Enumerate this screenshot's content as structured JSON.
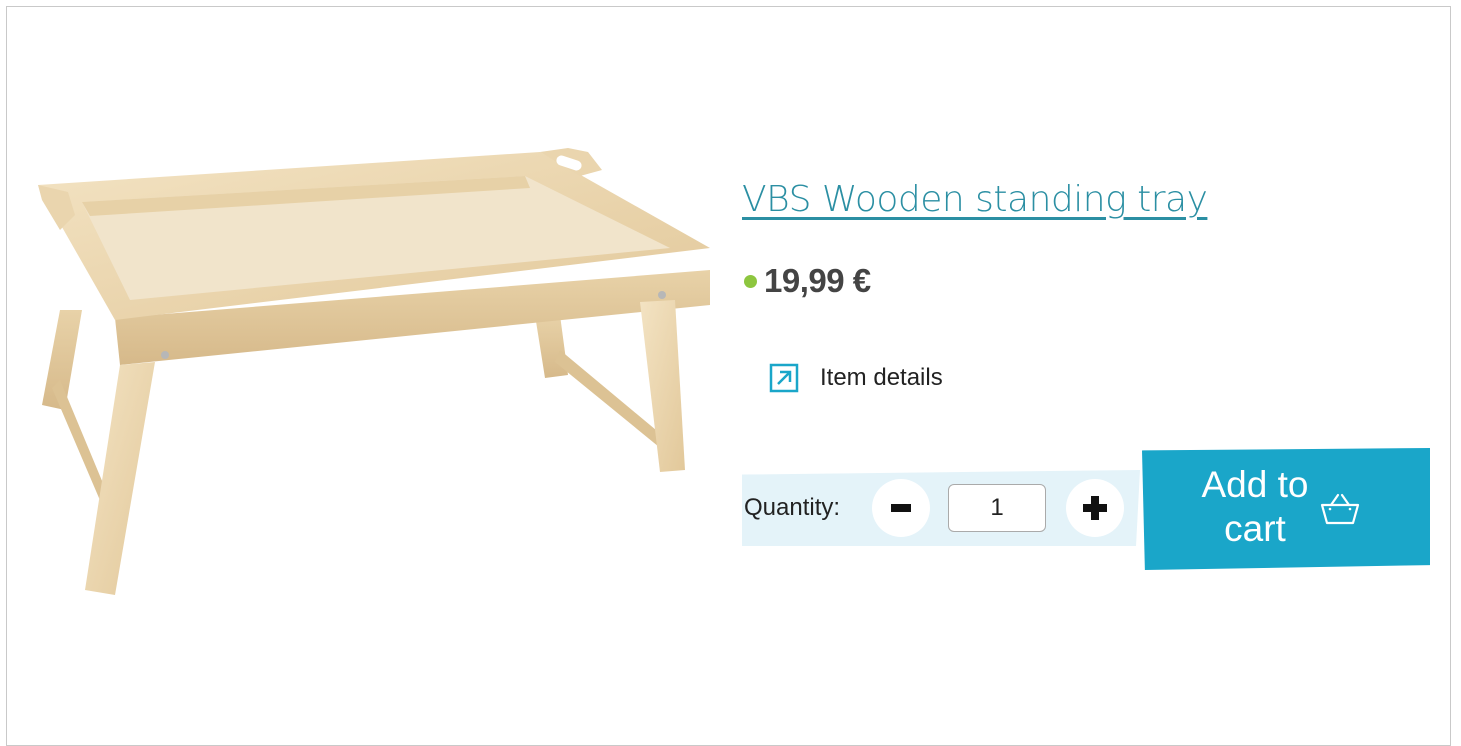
{
  "product": {
    "title": "VBS Wooden standing tray",
    "price": "19,99 €",
    "availability_color": "#8dc63f",
    "image_subject": "wooden bed tray with folding legs",
    "details_label": "Item details",
    "details_icon": "external-link-arrow-icon"
  },
  "quantity": {
    "label": "Quantity:",
    "value": "1",
    "decrease_icon": "minus-icon",
    "increase_icon": "plus-icon"
  },
  "cart": {
    "add_label": "Add to cart",
    "icon": "basket-icon"
  },
  "colors": {
    "accent": "#1aa6c9",
    "title_link": "#2b8fa3",
    "quantity_panel": "#e4f3f9",
    "price_text": "#444444"
  }
}
